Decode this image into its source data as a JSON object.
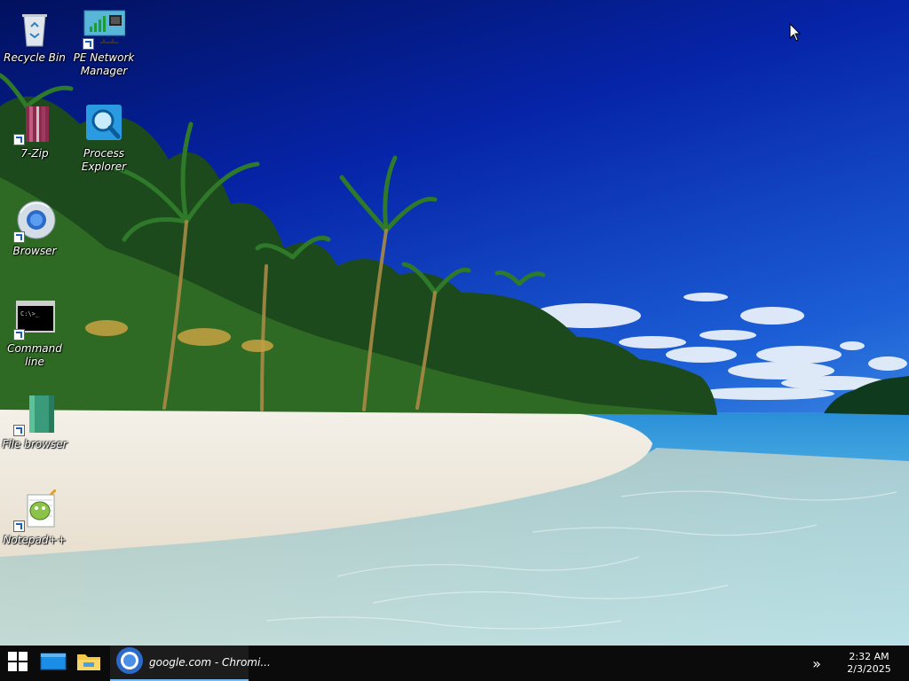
{
  "desktop": {
    "icons": [
      {
        "label": "Recycle Bin",
        "icon": "recycle-bin-icon"
      },
      {
        "label": "PE Network Manager",
        "icon": "network-manager-icon"
      },
      {
        "label": "7-Zip",
        "icon": "7zip-icon"
      },
      {
        "label": "Process Explorer",
        "icon": "process-explorer-icon"
      },
      {
        "label": "Browser",
        "icon": "browser-icon"
      },
      {
        "label": "Command line",
        "icon": "command-line-icon"
      },
      {
        "label": "File browser",
        "icon": "file-browser-icon"
      },
      {
        "label": "Notepad++",
        "icon": "notepadpp-icon"
      }
    ]
  },
  "taskbar": {
    "start_icon": "windows-start-icon",
    "pinned": [
      {
        "name": "desktop-icon"
      },
      {
        "name": "file-explorer-icon"
      }
    ],
    "open_window_title": "google.com - Chromi...",
    "tray_chevron": "»",
    "clock_time": "2:32 AM",
    "clock_date": "2/3/2025",
    "accent": "#76b9ed"
  }
}
